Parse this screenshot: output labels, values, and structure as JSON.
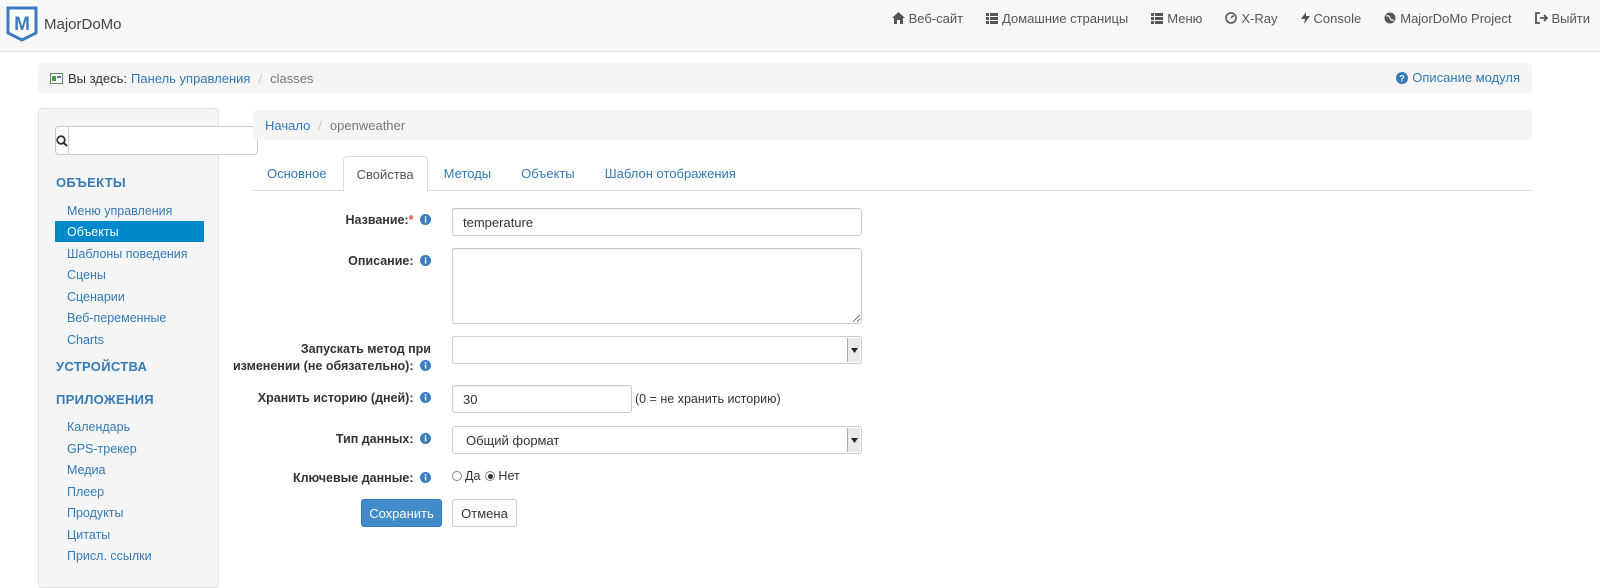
{
  "brand": {
    "logo_letter": "M",
    "name": "MajorDoMo"
  },
  "topnav": [
    {
      "label": "Веб-сайт",
      "icon": "home-icon"
    },
    {
      "label": "Домашние страницы",
      "icon": "list-icon"
    },
    {
      "label": "Меню",
      "icon": "list-icon"
    },
    {
      "label": "X-Ray",
      "icon": "dashboard-icon"
    },
    {
      "label": "Console",
      "icon": "flash-icon"
    },
    {
      "label": "MajorDoMo Project",
      "icon": "globe-icon"
    },
    {
      "label": "Выйти",
      "icon": "logout-icon"
    }
  ],
  "breadcrumb": {
    "prefix": "Вы здесь:",
    "link": "Панель управления",
    "current": "classes",
    "help": "Описание модуля"
  },
  "sidebar": {
    "search_value": "",
    "sections": [
      {
        "title": "ОБЪЕКТЫ"
      },
      {
        "title": "УСТРОЙСТВА"
      },
      {
        "title": "ПРИЛОЖЕНИЯ"
      }
    ],
    "objects_items": [
      "Меню управления",
      "Объекты",
      "Шаблоны поведения",
      "Сцены",
      "Сценарии",
      "Веб-переменные",
      "Charts"
    ],
    "apps_items": [
      "Календарь",
      "GPS-трекер",
      "Медиа",
      "Плеер",
      "Продукты",
      "Цитаты",
      "Присл. ссылки"
    ],
    "active_item": "Объекты"
  },
  "main_crumb": {
    "home": "Начало",
    "current": "openweather"
  },
  "tabs": [
    {
      "label": "Основное",
      "active": false
    },
    {
      "label": "Свойства",
      "active": true
    },
    {
      "label": "Методы",
      "active": false
    },
    {
      "label": "Объекты",
      "active": false
    },
    {
      "label": "Шаблон отображения",
      "active": false
    }
  ],
  "form": {
    "name_label": "Название:",
    "name_required": "*",
    "name_value": "temperature",
    "description_label": "Описание:",
    "description_value": "",
    "onchange_label_1": "Запускать метод при",
    "onchange_label_2": "изменении (не обязательно):",
    "onchange_value": "",
    "history_label": "Хранить историю (дней):",
    "history_value": "30",
    "history_hint": "(0 = не хранить историю)",
    "datatype_label": "Тип данных:",
    "datatype_value": "Общий формат",
    "keydata_label": "Ключевые данные:",
    "keydata_yes": "Да",
    "keydata_no": "Нет",
    "keydata_selected": "Нет",
    "save_label": "Сохранить",
    "cancel_label": "Отмена"
  },
  "colors": {
    "link": "#337ab7",
    "active_bg": "#0088cc",
    "primary": "#428bca",
    "required": "#d9534f"
  }
}
